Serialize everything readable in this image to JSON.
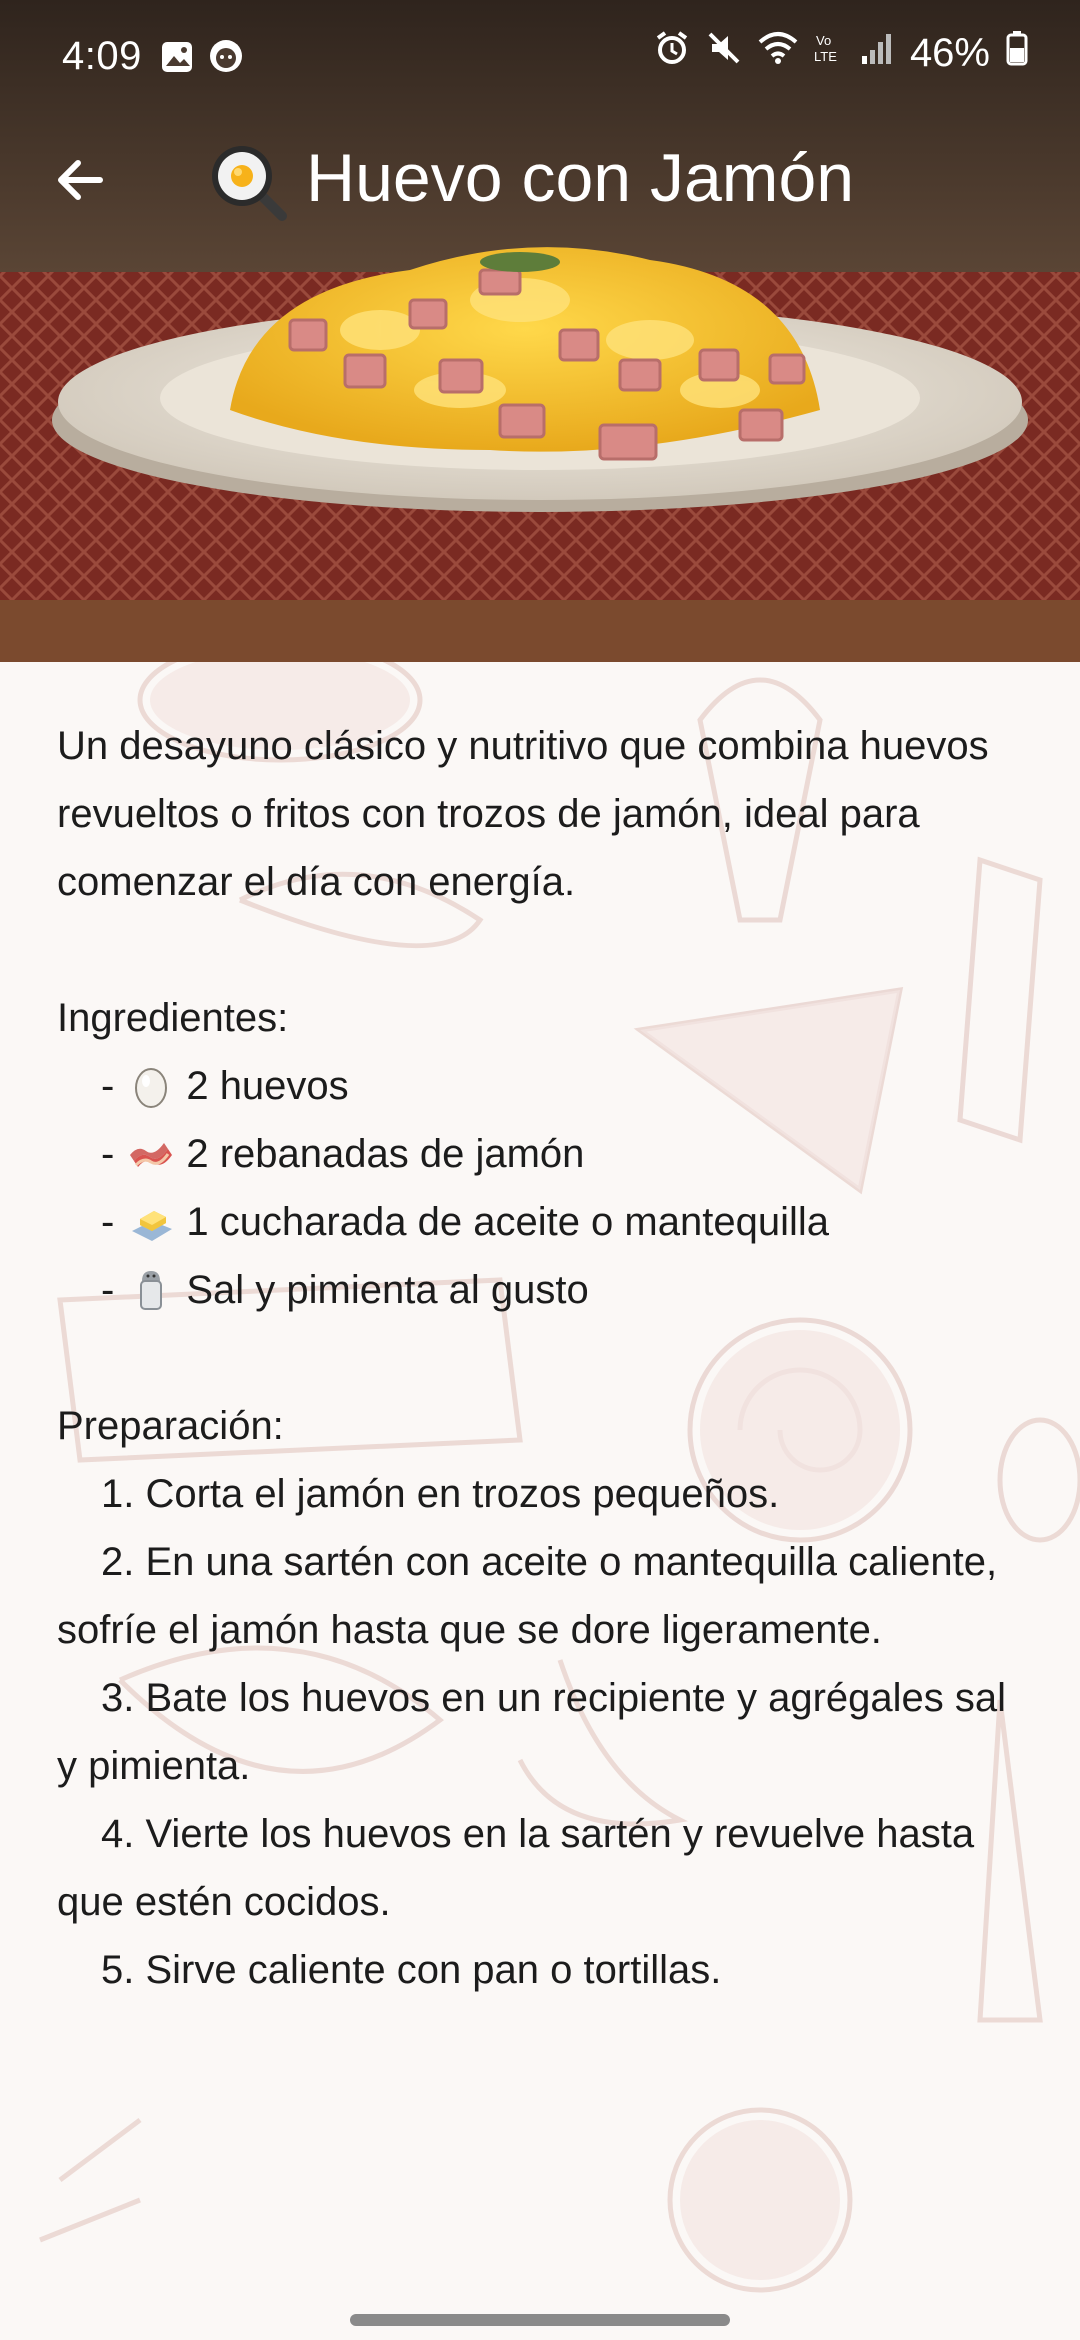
{
  "status_bar": {
    "time": "4:09",
    "battery": "46%",
    "left_icons": [
      "gallery-notification-icon",
      "app-notification-icon"
    ],
    "right_icons": [
      "alarm-icon",
      "mute-icon",
      "wifi-icon",
      "volte-icon",
      "signal-icon",
      "battery-icon"
    ]
  },
  "app_bar": {
    "title": "Huevo con Jamón",
    "title_icon": "fried-egg-pan-icon",
    "back_icon": "arrow-left-icon"
  },
  "recipe": {
    "description": "Un desayuno clásico y nutritivo que combina huevos revueltos o fritos con trozos de jamón, ideal para comenzar el día con energía.",
    "ingredients_heading": "Ingredientes:",
    "ingredients": [
      {
        "dash": "-",
        "icon": "egg-icon",
        "text": "2 huevos"
      },
      {
        "dash": "-",
        "icon": "bacon-icon",
        "text": "2 rebanadas de jamón"
      },
      {
        "dash": "-",
        "icon": "butter-icon",
        "text": "1 cucharada de aceite o mantequilla"
      },
      {
        "dash": "-",
        "icon": "salt-shaker-icon",
        "text": "Sal y pimienta al gusto"
      }
    ],
    "preparation_heading": "Preparación:",
    "steps": [
      "1. Corta el jamón en trozos pequeños.",
      "2. En una sartén con aceite o mantequilla caliente, sofríe el jamón hasta que se dore ligeramente.",
      "3. Bate los huevos en un recipiente y agrégales sal y pimienta.",
      "4. Vierte los huevos en la sartén y revuelve hasta que estén cocidos.",
      "5. Sirve caliente con pan o tortillas."
    ]
  },
  "colors": {
    "text": "#1c1c1c",
    "header_overlay": "#3a2a20",
    "egg": "#f6c533",
    "ham": "#d98a86",
    "placemat": "#7a2a22"
  }
}
